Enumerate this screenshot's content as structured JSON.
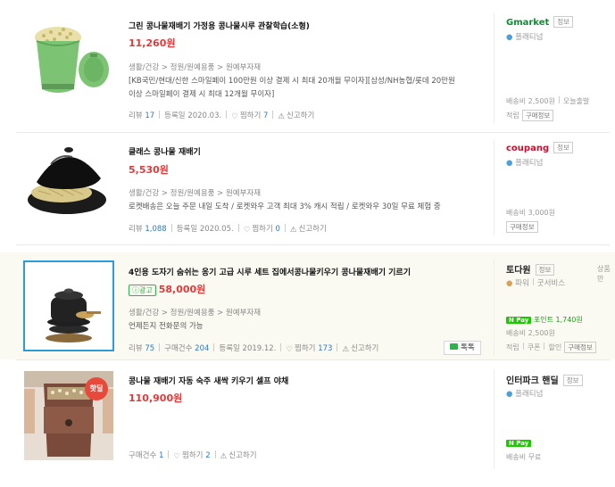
{
  "products": [
    {
      "title": "그린 콩나물재배기 가정용 콩나물시루 관찰학습(소형)",
      "price": "11,260원",
      "category": "생활/건강 > 정원/원예용품 > 원예부자재",
      "desc_line1": "[KB국민/현대/신한 스마일페이 100만원 이상 결제 시 최대 20개월 무이자][삼성/NH농협/롯데 20만원",
      "desc_line2": "이상 스마일페이 결제 시 최대 12개월 무이자]",
      "review_label": "리뷰",
      "review_count": "17",
      "reg_date": "등록일 2020.03.",
      "wish_label": "찜하기",
      "wish_count": "7",
      "report": "신고하기",
      "mall": "Gmarket",
      "mall_info": "정보",
      "grade": "플래티넘",
      "shipping": "배송비 2,500원",
      "extra": "오늘출발",
      "tags": [
        "적립",
        "구매정보"
      ]
    },
    {
      "title": "클래스 콩나물 재배기",
      "price": "5,530원",
      "category": "생활/건강 > 정원/원예용품 > 원예부자재",
      "desc_line1": "로켓배송은 오늘 주문 내일 도착 / 로켓와우 고객 최대 3% 캐시 적립 / 로켓와우 30일 무료 체험 중",
      "review_label": "리뷰",
      "review_count": "1,088",
      "reg_date": "등록일 2020.05.",
      "wish_label": "찜하기",
      "wish_count": "0",
      "report": "신고하기",
      "mall": "coupang",
      "mall_info": "정보",
      "grade": "플래티넘",
      "shipping": "배송비 3,000원",
      "tags": [
        "구매정보"
      ]
    },
    {
      "ad_label": "광고",
      "title": "4인용 도자기 숨쉬는 옹기 고급 시루 세트 집에서콩나물키우기 콩나물재배기 기르기",
      "price": "58,000원",
      "category": "생활/건강 > 정원/원예용품 > 원예부자재",
      "desc_line1": "언제든지 전화문의 가능",
      "review_label": "리뷰",
      "review_count": "75",
      "purchase_label": "구매건수",
      "purchase_count": "204",
      "reg_date": "등록일 2019.12.",
      "wish_label": "찜하기",
      "wish_count": "173",
      "report": "신고하기",
      "talk": "톡톡",
      "mall": "토다원",
      "mall_info": "정보",
      "grade": "파워",
      "service": "굿서비스",
      "npay_point": "포인트 1,740원",
      "shipping": "배송비 2,500원",
      "tags": [
        "적립",
        "쿠폰",
        "할인",
        "구매정보"
      ],
      "store_info": "상품만"
    },
    {
      "hot_badge": "핫딜",
      "title": "콩나물 재배기 자동 숙주 새싹 키우기 셀프 야채",
      "price": "110,900원",
      "purchase_label": "구매건수",
      "purchase_count": "1",
      "wish_label": "찜하기",
      "wish_count": "2",
      "report": "신고하기",
      "mall": "인터파크 핸딜",
      "mall_info": "정보",
      "grade": "플래티넘",
      "npay": "N Pay",
      "shipping": "배송비 무료"
    }
  ],
  "colors": {
    "price": "#e03a3a",
    "accent_blue": "#2a7bbd",
    "npay": "#1ec800",
    "ad_green": "#2fb24b"
  }
}
